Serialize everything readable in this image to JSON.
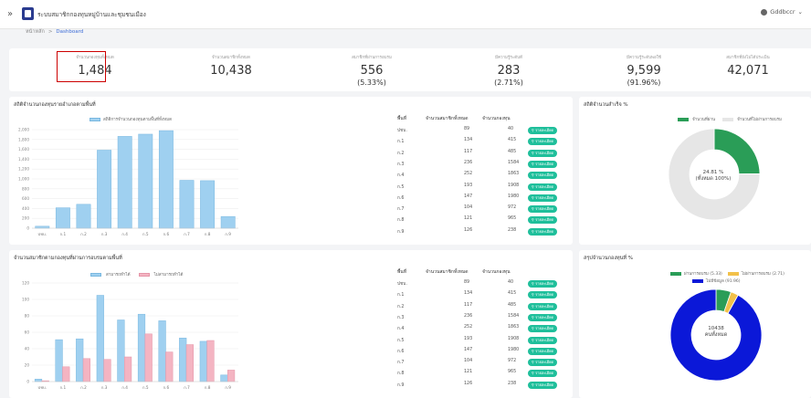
{
  "app": {
    "title": "ระบบสมาชิกกองทุนหมู่บ้านและชุมชนเมือง",
    "menu_icon": "»",
    "user": "Gddbccr"
  },
  "breadcrumb": {
    "home": "หน้าหลัก",
    "separator": ">",
    "current": "Dashboard"
  },
  "stats": [
    {
      "label": "จำนวนกองทุนทั้งหมด",
      "value": "1,484",
      "pct": ""
    },
    {
      "label": "จำนวนสมาชิกทั้งหมด",
      "value": "10,438",
      "pct": ""
    },
    {
      "label": "สมาชิกที่ผ่านการอบรม",
      "value": "556",
      "pct": "(5.33%)"
    },
    {
      "label": "มีความรู้ระดับดี",
      "value": "283",
      "pct": "(2.71%)"
    },
    {
      "label": "มีความรู้ระดับพอใช้",
      "value": "9,599",
      "pct": "(91.96%)"
    },
    {
      "label": "สมาชิกที่ยังไม่ได้ประเมิน",
      "value": "42,071",
      "pct": ""
    }
  ],
  "colors": {
    "accent": "#3b6bd6",
    "bar_blue": "#9fd0f0",
    "bar_pink": "#f4b4c2",
    "green": "#2a9d57",
    "teal_button": "#1fbf9b",
    "pie_blue": "#0b18d8",
    "pie_yellow": "#f2c14a",
    "highlight_box": "#cc0000"
  },
  "card1": {
    "title": "สถิติจำนวนกองทุนรายอำเภอตามพื้นที่",
    "legend": "สถิติการจำนวนกองทุนตามพื้นที่ทั้งหมด",
    "chart_data": {
      "type": "bar",
      "categories": [
        "ปชบ.",
        "ก.1",
        "ก.2",
        "ก.3",
        "ก.4",
        "ก.5",
        "ก.6",
        "ก.7",
        "ก.8",
        "ก.9"
      ],
      "ylim": [
        0,
        2000
      ],
      "yticks": [
        0,
        200,
        400,
        600,
        800,
        1000,
        1200,
        1400,
        1600,
        1800,
        2000
      ],
      "ytick_labels": [
        "0",
        "200",
        "400",
        "600",
        "800",
        "1,000",
        "1,200",
        "1,400",
        "1,600",
        "1,800",
        "2,000"
      ],
      "series": [
        {
          "name": "สถิติการจำนวนกองทุนตามพื้นที่ทั้งหมด",
          "values": [
            40,
            415,
            485,
            1584,
            1863,
            1908,
            1980,
            972,
            965,
            238
          ]
        }
      ]
    }
  },
  "card2": {
    "title": "จำนวนสมาชิกตามกองทุนที่ผ่านการอบรมตามพื้นที่",
    "legend": [
      "สามารถทำได้",
      "ไม่สามารถทำได้"
    ],
    "chart_data": {
      "type": "bar",
      "categories": [
        "ปชบ.",
        "ก.1",
        "ก.2",
        "ก.3",
        "ก.4",
        "ก.5",
        "ก.6",
        "ก.7",
        "ก.8",
        "ก.9"
      ],
      "ylim": [
        0,
        120
      ],
      "yticks": [
        0,
        20,
        40,
        60,
        80,
        100,
        120
      ],
      "series": [
        {
          "name": "สามารถทำได้",
          "values": [
            3,
            51,
            52,
            105,
            75,
            82,
            74,
            53,
            49,
            8
          ]
        },
        {
          "name": "ไม่สามารถทำได้",
          "values": [
            1,
            18,
            28,
            27,
            30,
            58,
            36,
            45,
            50,
            14
          ]
        }
      ]
    }
  },
  "table": {
    "headers": [
      "พื้นที่",
      "จำนวนสมาชิกทั้งหมด",
      "จำนวนกองทุน",
      ""
    ],
    "button_label": "รายละเอียด",
    "rows": [
      {
        "area": "ปชบ.",
        "members": "89",
        "funds": "40"
      },
      {
        "area": "ก.1",
        "members": "134",
        "funds": "415"
      },
      {
        "area": "ก.2",
        "members": "117",
        "funds": "485"
      },
      {
        "area": "ก.3",
        "members": "236",
        "funds": "1584"
      },
      {
        "area": "ก.4",
        "members": "252",
        "funds": "1863"
      },
      {
        "area": "ก.5",
        "members": "193",
        "funds": "1908"
      },
      {
        "area": "ก.6",
        "members": "147",
        "funds": "1980"
      },
      {
        "area": "ก.7",
        "members": "104",
        "funds": "972"
      },
      {
        "area": "ก.8",
        "members": "121",
        "funds": "965"
      },
      {
        "area": "ก.9",
        "members": "126",
        "funds": "238"
      }
    ]
  },
  "donut1": {
    "title": "สถิติจำนวนสำเร็จ %",
    "legend": [
      "จำนวนที่ผ่าน",
      "จำนวนที่ไม่ผ่านการอบรม"
    ],
    "center_line1": "24.81 %",
    "center_line2": "(ทั้งหมด 100%)",
    "chart_data": {
      "type": "pie",
      "labels": [
        "จำนวนที่ผ่าน",
        "จำนวนที่ไม่ผ่านการอบรม"
      ],
      "values": [
        24.81,
        75.19
      ]
    }
  },
  "donut2": {
    "title": "สรุปจำนวนกองทุนที่ %",
    "legend": [
      "ผ่านการอบรม (5.33)",
      "ไม่ผ่านการอบรม (2.71)",
      "ไม่มีข้อมูล (91.96)"
    ],
    "center_line1": "10438",
    "center_line2": "คนทั้งหมด",
    "chart_data": {
      "type": "pie",
      "labels": [
        "ผ่านการอบรม",
        "ไม่ผ่านการอบรม",
        "ไม่มีข้อมูล"
      ],
      "values": [
        5.33,
        2.71,
        91.96
      ]
    }
  }
}
